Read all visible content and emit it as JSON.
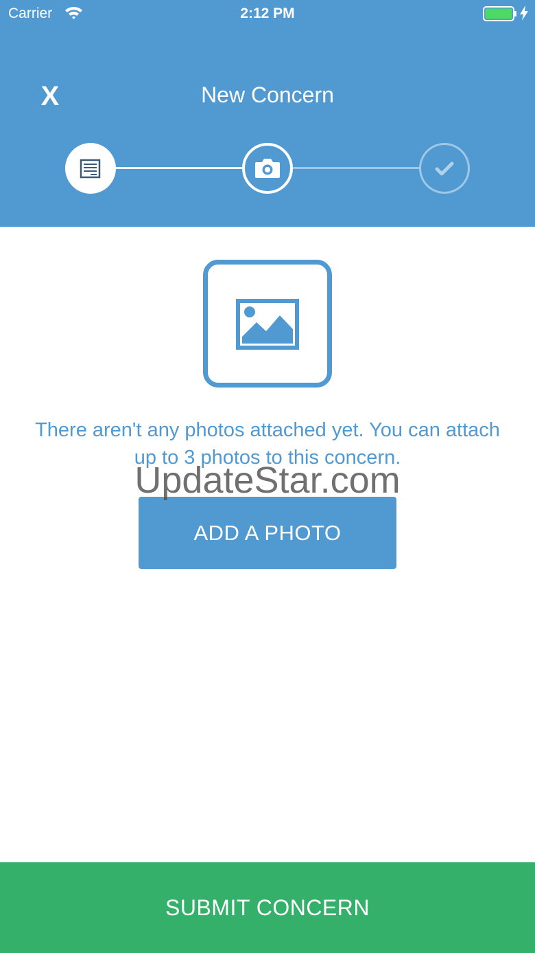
{
  "status_bar": {
    "carrier": "Carrier",
    "time": "2:12 PM",
    "icons": [
      "wifi-icon",
      "battery-icon",
      "charging-icon"
    ]
  },
  "header": {
    "close_label": "X",
    "title": "New Concern"
  },
  "stepper": {
    "steps": [
      {
        "icon": "form-icon",
        "state": "completed"
      },
      {
        "icon": "camera-icon",
        "state": "active"
      },
      {
        "icon": "checkmark-icon",
        "state": "pending"
      }
    ]
  },
  "content": {
    "placeholder_icon": "image-icon",
    "message": "There aren't any photos attached yet. You can attach up to 3 photos to this concern.",
    "add_photo_label": "ADD A PHOTO"
  },
  "watermark": "UpdateStar.com",
  "footer": {
    "submit_label": "SUBMIT CONCERN"
  },
  "colors": {
    "header": "#5199D1",
    "accent": "#5199D1",
    "submit": "#34B06A",
    "battery": "#4CD964"
  }
}
